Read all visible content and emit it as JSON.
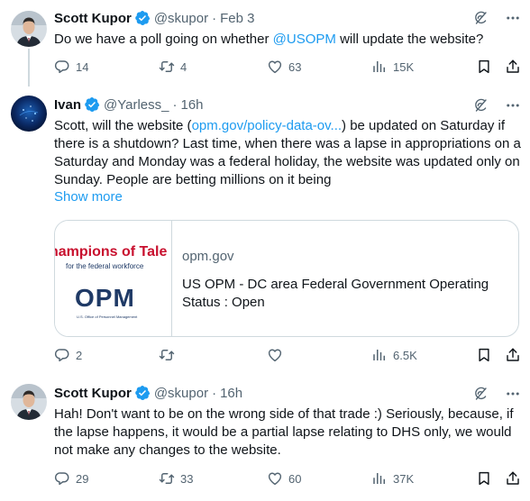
{
  "tweets": [
    {
      "name": "Scott Kupor",
      "handle": "@skupor",
      "separator": "·",
      "date": "Feb 3",
      "text_pre": "Do we have a poll going on whether ",
      "mention": "@USOPM",
      "text_post": " will update the website?",
      "replies": "14",
      "retweets": "4",
      "likes": "63",
      "views": "15K"
    },
    {
      "name": "Ivan",
      "handle": "@Yarless_",
      "separator": "·",
      "date": "16h",
      "text_pre": "Scott, will the website (",
      "link": "opm.gov/policy-data-ov...",
      "text_post": ") be updated on Saturday if there is a shutdown? Last time, when there was a lapse in appropriations on a Saturday and Monday was a federal holiday, the website was updated only on Sunday. People are betting millions on it being",
      "show_more": "Show more",
      "card": {
        "image_banner": "hampions of Tale",
        "image_sub": "for the federal workforce",
        "image_logo": "OPM",
        "image_logo_sub": "U.S. Office of Personnel Management",
        "domain": "opm.gov",
        "title": "US OPM - DC area Federal Government Operating Status : Open"
      },
      "replies": "2",
      "retweets": "",
      "likes": "",
      "views": "6.5K"
    },
    {
      "name": "Scott Kupor",
      "handle": "@skupor",
      "separator": "·",
      "date": "16h",
      "text": "Hah! Don't want to be on the wrong side of that trade :) Seriously, because, if the lapse happens, it would be a partial lapse relating to DHS only, we would not make any changes to the website.",
      "replies": "29",
      "retweets": "33",
      "likes": "60",
      "views": "37K"
    }
  ],
  "colors": {
    "accent": "#1d9bf0",
    "secondary_text": "#536471",
    "primary_text": "#0f1419",
    "verified": "#1d9bf0"
  },
  "icons": [
    "verified-badge-icon",
    "grok-icon",
    "more-icon",
    "reply-icon",
    "retweet-icon",
    "like-icon",
    "views-icon",
    "bookmark-icon",
    "share-icon"
  ]
}
